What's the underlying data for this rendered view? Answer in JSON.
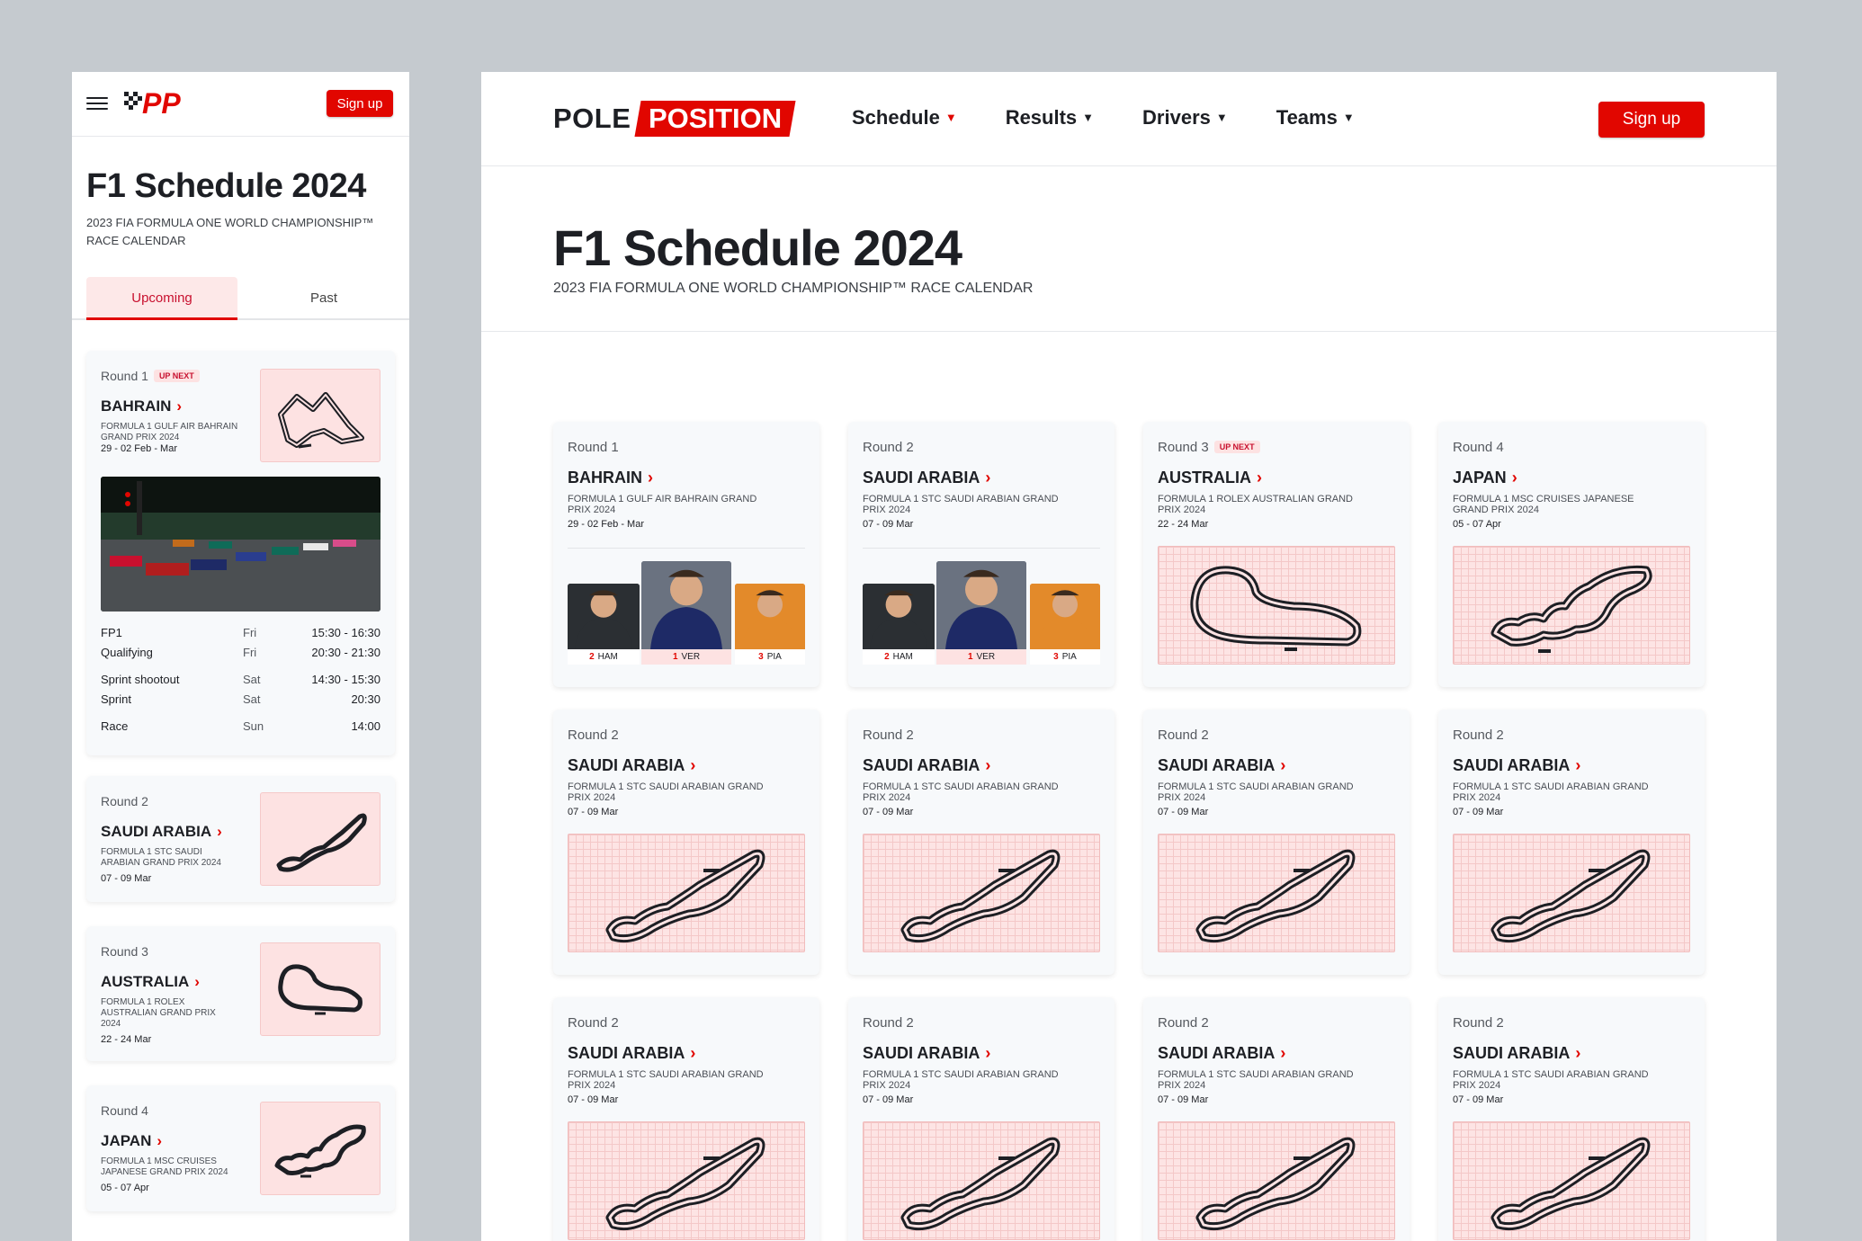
{
  "brand": {
    "short": "PP",
    "word1": "POLE",
    "word2": "POSITION",
    "accent": "#e10600"
  },
  "nav": {
    "items": [
      {
        "label": "Schedule",
        "active": true
      },
      {
        "label": "Results",
        "active": false
      },
      {
        "label": "Drivers",
        "active": false
      },
      {
        "label": "Teams",
        "active": false
      }
    ],
    "signup": "Sign up",
    "menu_icon": "hamburger-icon",
    "caret_icon": "chevron-down-icon"
  },
  "page": {
    "title": "F1 Schedule 2024",
    "subtitle": "2023 FIA FORMULA ONE WORLD CHAMPIONSHIP™ RACE CALENDAR"
  },
  "mobile": {
    "tabs": [
      {
        "label": "Upcoming",
        "active": true
      },
      {
        "label": "Past",
        "active": false
      }
    ],
    "cards": [
      {
        "round": "Round 1",
        "badge": "UP NEXT",
        "country": "BAHRAIN",
        "gp": "FORMULA 1 GULF AIR BAHRAIN GRAND PRIX 2024",
        "date": "29 - 02 Feb - Mar",
        "track": "bahrain",
        "sessions": [
          {
            "name": "FP1",
            "day": "Fri",
            "time": "15:30 - 16:30"
          },
          {
            "name": "Qualifying",
            "day": "Fri",
            "time": "20:30 - 21:30"
          },
          {
            "name": "Sprint shootout",
            "day": "Sat",
            "time": "14:30 - 15:30"
          },
          {
            "name": "Sprint",
            "day": "Sat",
            "time": "20:30"
          },
          {
            "name": "Race",
            "day": "Sun",
            "time": "14:00"
          }
        ]
      },
      {
        "round": "Round 2",
        "country": "SAUDI ARABIA",
        "gp": "FORMULA 1 STC SAUDI ARABIAN GRAND PRIX 2024",
        "date": "07 - 09 Mar",
        "track": "saudi"
      },
      {
        "round": "Round 3",
        "country": "AUSTRALIA",
        "gp": "FORMULA 1 ROLEX AUSTRALIAN GRAND PRIX 2024",
        "date": "22 - 24 Mar",
        "track": "australia"
      },
      {
        "round": "Round 4",
        "country": "JAPAN",
        "gp": "FORMULA 1 MSC CRUISES JAPANESE GRAND PRIX 2024",
        "date": "05 - 07 Apr",
        "track": "japan"
      }
    ]
  },
  "desktop": {
    "cards": [
      {
        "round": "Round 1",
        "country": "BAHRAIN",
        "gp": "FORMULA 1 GULF AIR BAHRAIN GRAND PRIX 2024",
        "date": "29 - 02 Feb - Mar",
        "podium": [
          {
            "pos": "2",
            "code": "HAM"
          },
          {
            "pos": "1",
            "code": "VER"
          },
          {
            "pos": "3",
            "code": "PIA"
          }
        ]
      },
      {
        "round": "Round 2",
        "country": "SAUDI ARABIA",
        "gp": "FORMULA 1 STC SAUDI ARABIAN GRAND PRIX 2024",
        "date": "07 - 09 Mar",
        "podium": [
          {
            "pos": "2",
            "code": "HAM"
          },
          {
            "pos": "1",
            "code": "VER"
          },
          {
            "pos": "3",
            "code": "PIA"
          }
        ]
      },
      {
        "round": "Round 3",
        "badge": "UP NEXT",
        "country": "AUSTRALIA",
        "gp": "FORMULA 1 ROLEX AUSTRALIAN GRAND PRIX 2024",
        "date": "22 - 24 Mar",
        "track": "australia"
      },
      {
        "round": "Round 4",
        "country": "JAPAN",
        "gp": "FORMULA 1 MSC CRUISES JAPANESE GRAND PRIX 2024",
        "date": "05 - 07 Apr",
        "track": "japan"
      },
      {
        "round": "Round 2",
        "country": "SAUDI ARABIA",
        "gp": "FORMULA 1 STC SAUDI ARABIAN GRAND PRIX 2024",
        "date": "07 - 09 Mar",
        "track": "saudi"
      },
      {
        "round": "Round 2",
        "country": "SAUDI ARABIA",
        "gp": "FORMULA 1 STC SAUDI ARABIAN GRAND PRIX 2024",
        "date": "07 - 09 Mar",
        "track": "saudi"
      },
      {
        "round": "Round 2",
        "country": "SAUDI ARABIA",
        "gp": "FORMULA 1 STC SAUDI ARABIAN GRAND PRIX 2024",
        "date": "07 - 09 Mar",
        "track": "saudi"
      },
      {
        "round": "Round 2",
        "country": "SAUDI ARABIA",
        "gp": "FORMULA 1 STC SAUDI ARABIAN GRAND PRIX 2024",
        "date": "07 - 09 Mar",
        "track": "saudi"
      },
      {
        "round": "Round 2",
        "country": "SAUDI ARABIA",
        "gp": "FORMULA 1 STC SAUDI ARABIAN GRAND PRIX 2024",
        "date": "07 - 09 Mar",
        "track": "saudi"
      },
      {
        "round": "Round 2",
        "country": "SAUDI ARABIA",
        "gp": "FORMULA 1 STC SAUDI ARABIAN GRAND PRIX 2024",
        "date": "07 - 09 Mar",
        "track": "saudi"
      },
      {
        "round": "Round 2",
        "country": "SAUDI ARABIA",
        "gp": "FORMULA 1 STC SAUDI ARABIAN GRAND PRIX 2024",
        "date": "07 - 09 Mar",
        "track": "saudi"
      },
      {
        "round": "Round 2",
        "country": "SAUDI ARABIA",
        "gp": "FORMULA 1 STC SAUDI ARABIAN GRAND PRIX 2024",
        "date": "07 - 09 Mar",
        "track": "saudi"
      }
    ]
  }
}
